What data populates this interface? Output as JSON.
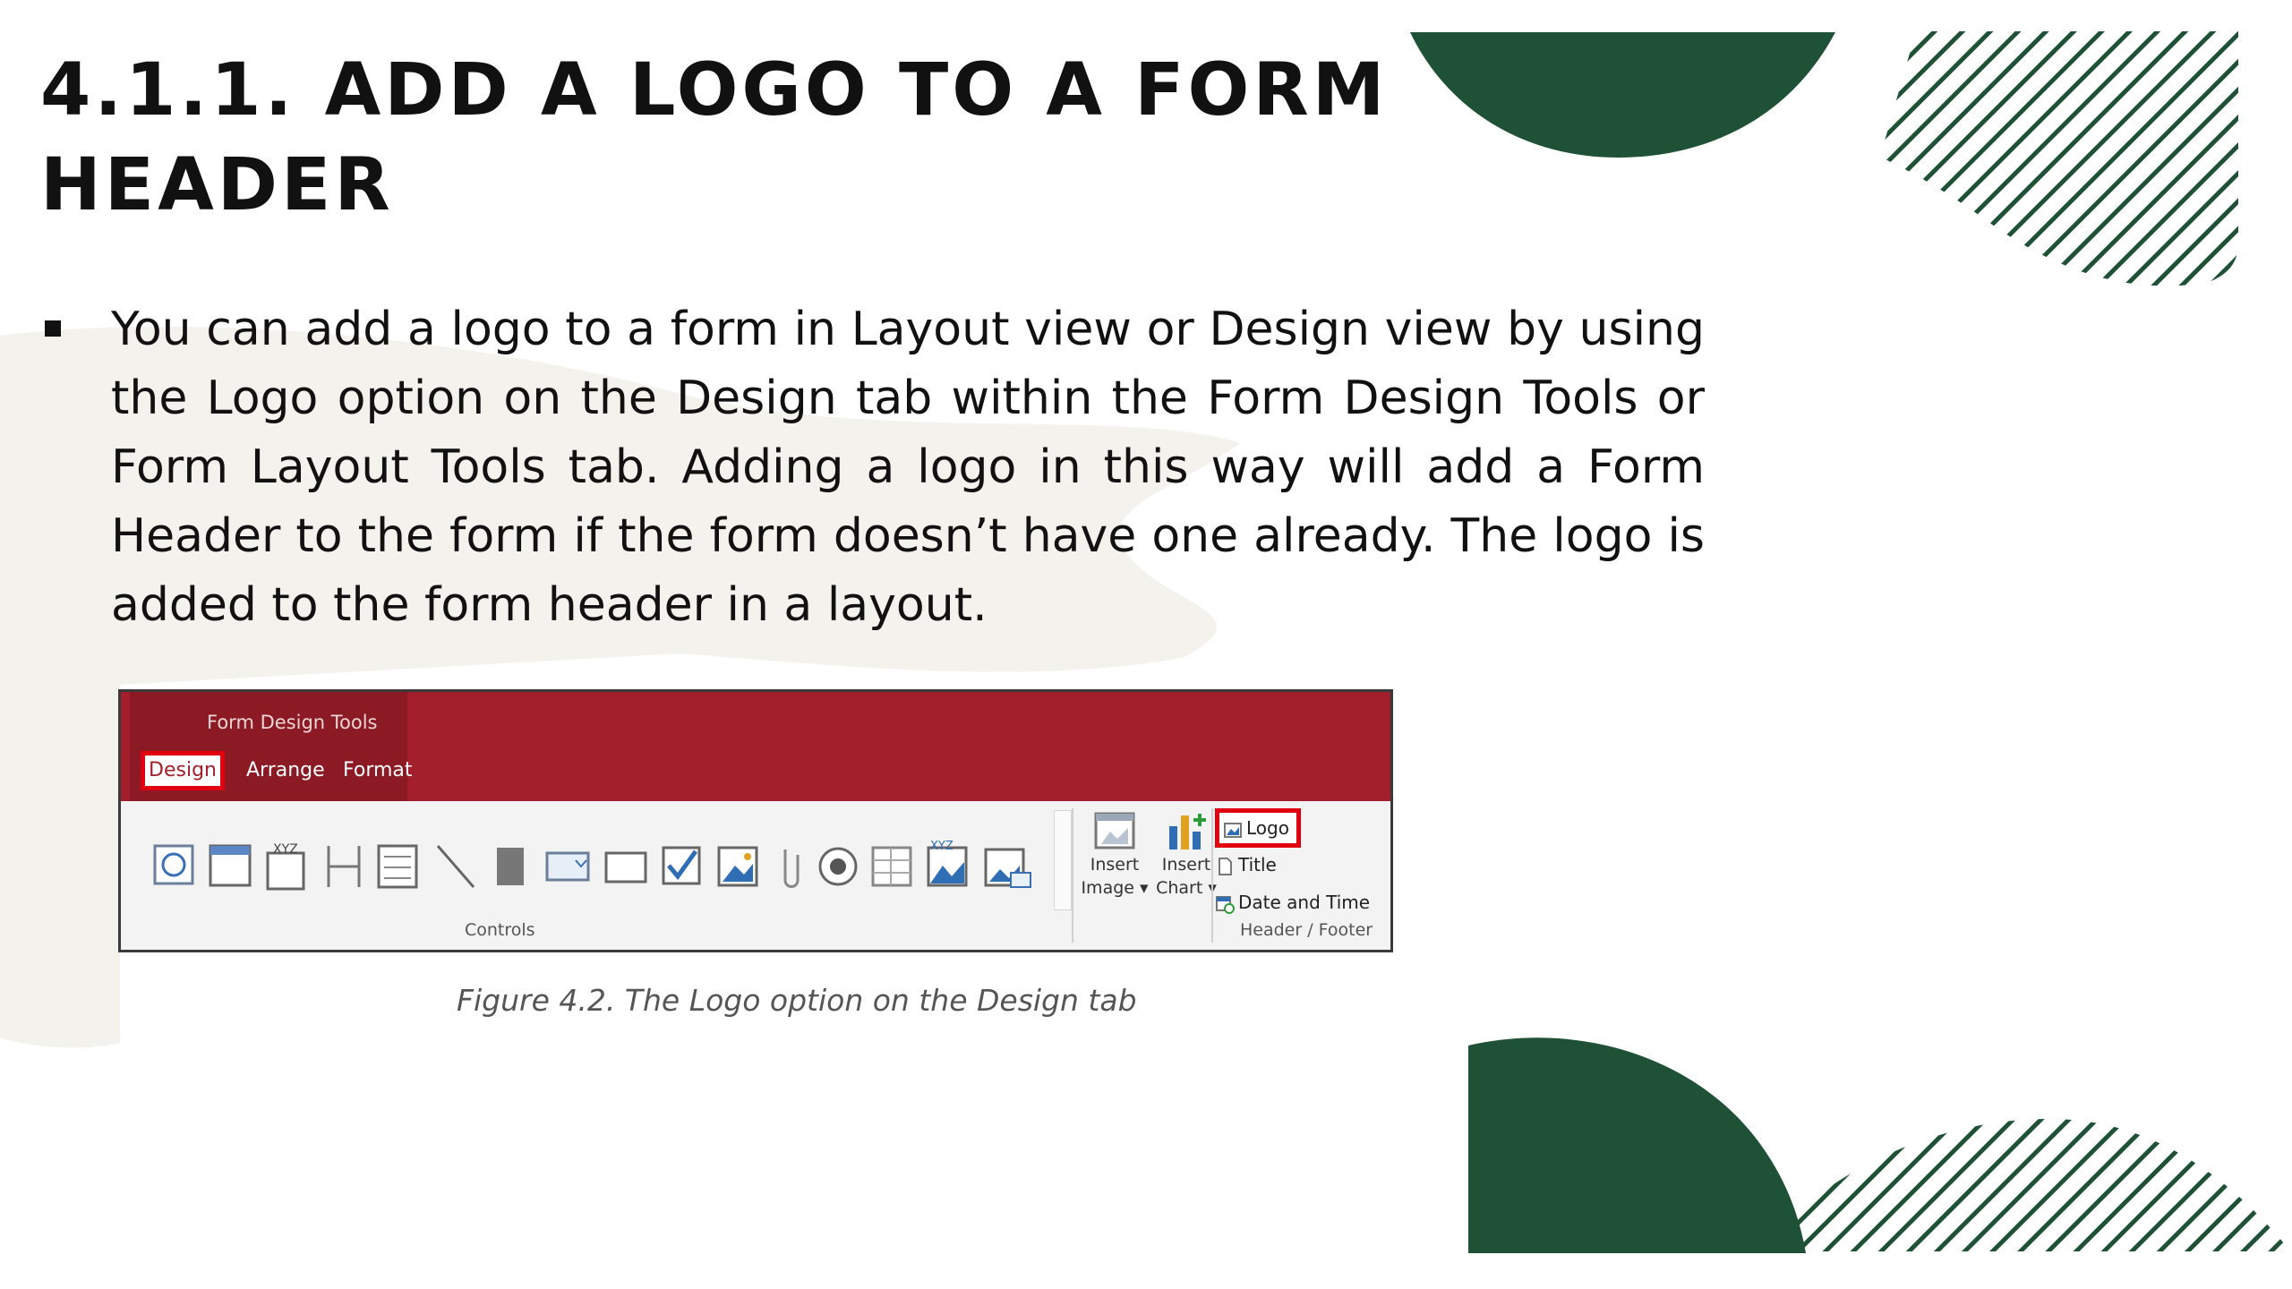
{
  "slide": {
    "title_line1": "4.1.1. ADD A LOGO TO A FORM",
    "title_line2": "HEADER",
    "bullet": "You can add a logo to a form in Layout view or Design view by using the Logo option on the Design tab within the Form Design Tools or Form Layout Tools tab. Adding a logo in this way will add a Form Header to the form if the form doesn’t have one already. The logo is added to the form header in a layout.",
    "caption": "Figure 4.2. The Logo option on the Design tab"
  },
  "ribbon": {
    "context_title": "Form Design Tools",
    "tabs": [
      "Design",
      "Arrange",
      "Format"
    ],
    "selected_tab": "Design",
    "groups": [
      "Controls",
      "Header / Footer"
    ],
    "insert_image": [
      "Insert",
      "Image ▾"
    ],
    "insert_chart": [
      "Insert",
      "Chart ▾"
    ],
    "header_footer_items": [
      "Logo",
      "Title",
      "Date and Time"
    ],
    "icons": [
      "web-browser-control-icon",
      "navigation-control-icon",
      "option-group-icon",
      "page-break-icon",
      "subform-icon",
      "line-icon",
      "toggle-button-icon",
      "combo-box-icon",
      "rectangle-icon",
      "check-box-icon",
      "image-icon",
      "attachment-icon",
      "option-button-icon",
      "list-box-icon",
      "unbound-object-frame-icon",
      "bound-object-frame-icon"
    ]
  },
  "colors": {
    "accent_green": "#1f5137",
    "ribbon_red": "#a21f2b",
    "highlight_red": "#e0000f",
    "brush_cream": "#f3f2ec"
  }
}
